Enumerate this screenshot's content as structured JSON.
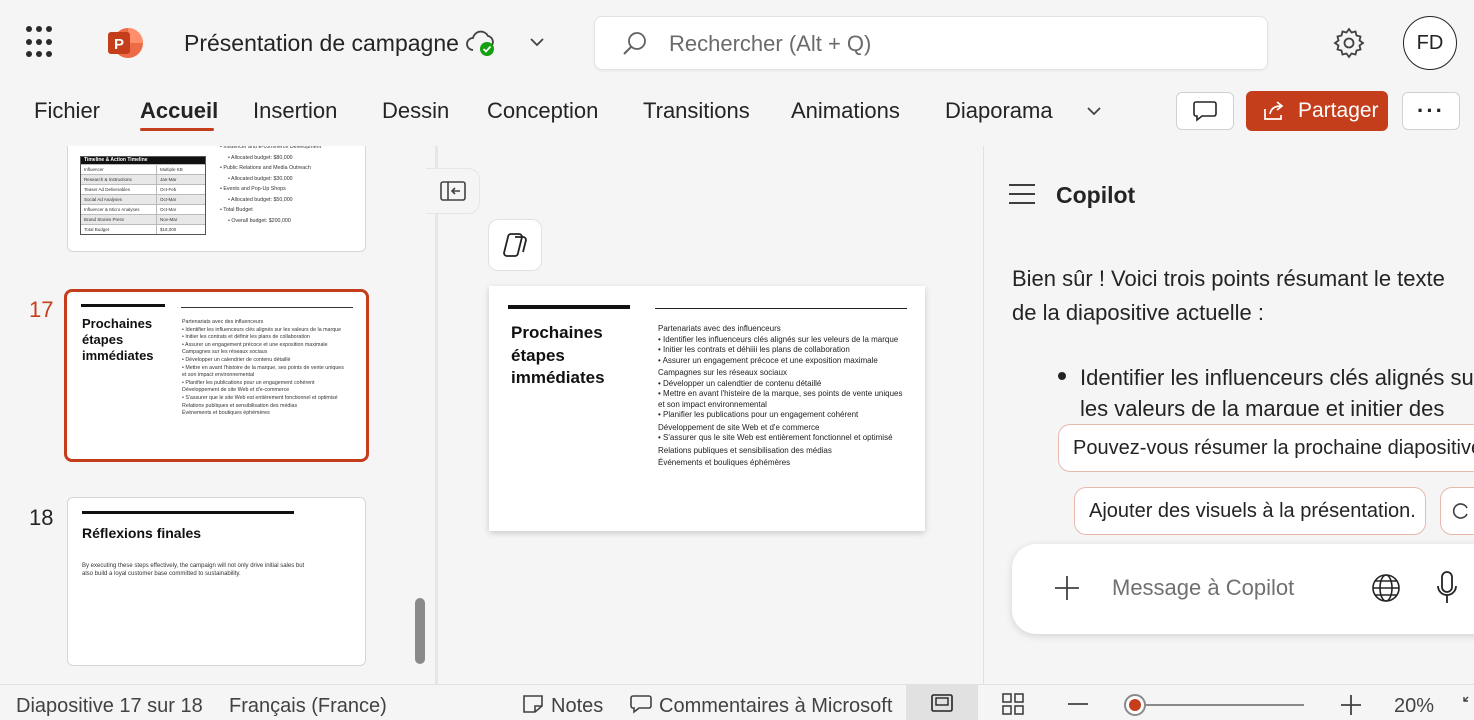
{
  "app": {
    "document_title": "Présentation de campagne",
    "search_placeholder": "Rechercher (Alt + Q)",
    "user_initials": "FD"
  },
  "ribbon": {
    "tabs": [
      "Fichier",
      "Accueil",
      "Insertion",
      "Dessin",
      "Conception",
      "Transitions",
      "Animations",
      "Diaporama"
    ],
    "active_tab": "Accueil",
    "share_label": "Partager",
    "more_label": "···"
  },
  "thumbnails": {
    "slide16": {
      "table_header": "Timeline & Action Timeline",
      "rows": [
        [
          "Influencer",
          "Multiple KB"
        ],
        [
          "Research & Instructions",
          "Jan-Mar"
        ],
        [
          "Teaser Ad Deliverables",
          "Oct-Feb"
        ],
        [
          "Social Ad Analyses",
          "Oct-Mar"
        ],
        [
          "Influencer & Micro Analyses",
          "Oct-Mar"
        ],
        [
          "Brand Stories Press",
          "Nov-Mar"
        ],
        [
          "Total Budget",
          "$18,000"
        ]
      ],
      "bullets": [
        "Influencer and E-commerce Development",
        "Allocated budget: $80,000",
        "Public Relations and Media Outreach",
        "Allocated budget: $30,000",
        "Events and Pop-Up Shops",
        "Allocated budget: $50,000",
        "Total Budget",
        "Overall budget: $200,000"
      ]
    },
    "slide17": {
      "number": "17",
      "title": "Prochaines étapes immédiates",
      "lines": [
        "Partenariats avec des influenceurs",
        "• Identifier les influenceurs clés alignés sur les valeurs de la marque",
        "• Initier les contrats et définir les plans de collaboration",
        "• Assurer un engagement précoce et une exposition maximale",
        "Campagnes sur les réseaux sociaux",
        "• Développer un calendrier de contenu détaillé",
        "• Mettre en avant l'histoire de la marque, ses points de vente uniques",
        "   et son impact environnemental",
        "• Planifier les publications pour un engagement cohérent",
        "Développement de site Web et d'e-commerce",
        "• S'assurer que le site Web est entièrement fonctionnel et optimisé",
        "Relations publiques et sensibilisation des médias",
        "Événements et boutiques éphémères"
      ]
    },
    "slide18": {
      "number": "18",
      "title": "Réflexions finales",
      "body": "By executing these steps effectively, the campaign will not only drive initial sales but also build a loyal customer base committed to sustainability."
    }
  },
  "main_slide": {
    "title_lines": [
      "Prochaines",
      "étapes",
      "immédiates"
    ],
    "lines": [
      "Partenariats avec des influenceurs",
      "•   Identifier les influenceurs clés alignés sur les veleurs de la marque",
      "•   Initier les contrats et déhiiii les plans de collaboration",
      "•   Assurer un engagement précoce et une exposition maximale",
      "Campagnes sur les réseaux sociaux",
      "•   Développer un calendtier de contenu détaillé",
      "•   Mettre en avant l'histeire de la marque, ses points de vente uniques",
      "     et son impact environnemental",
      "•   Planifier les publications pour un engagement cohérent",
      "Développement de site Web et d'e  commerce",
      "•   S'assurer qus le site Web est entièrement fonctionnel et optimisé",
      "Relations publiques et sensibilisation des médias",
      "Événements et bouliques éphémères"
    ]
  },
  "copilot": {
    "title": "Copilot",
    "reply": "Bien sûr ! Voici trois points résumant le texte de la diapositive actuelle :",
    "bullet": "Identifier les influenceurs clés alignés sur les valeurs de la marque et initier des contrats",
    "suggestion_1": "Pouvez-vous résumer la prochaine diapositive",
    "suggestion_2": "Ajouter des visuels à la présentation.",
    "composer_placeholder": "Message à Copilot"
  },
  "status_bar": {
    "slide_position": "Diapositive 17 sur 18",
    "language": "Français (France)",
    "notes": "Notes",
    "comments": "Commentaires à Microsoft",
    "zoom_value": "20%"
  },
  "colors": {
    "accent": "#c43e1c",
    "background": "#f5f5f5",
    "cloud_check": "#13a10e"
  },
  "icons": [
    "waffle-icon",
    "powerpoint-icon",
    "cloud-sync-icon",
    "chevron-down-icon",
    "search-icon",
    "gear-icon",
    "comment-icon",
    "share-icon",
    "collapse-pane-icon",
    "copilot-icon",
    "hamburger-icon",
    "plus-icon",
    "globe-icon",
    "mic-icon",
    "notes-icon",
    "normal-view-icon",
    "grid-view-icon"
  ]
}
